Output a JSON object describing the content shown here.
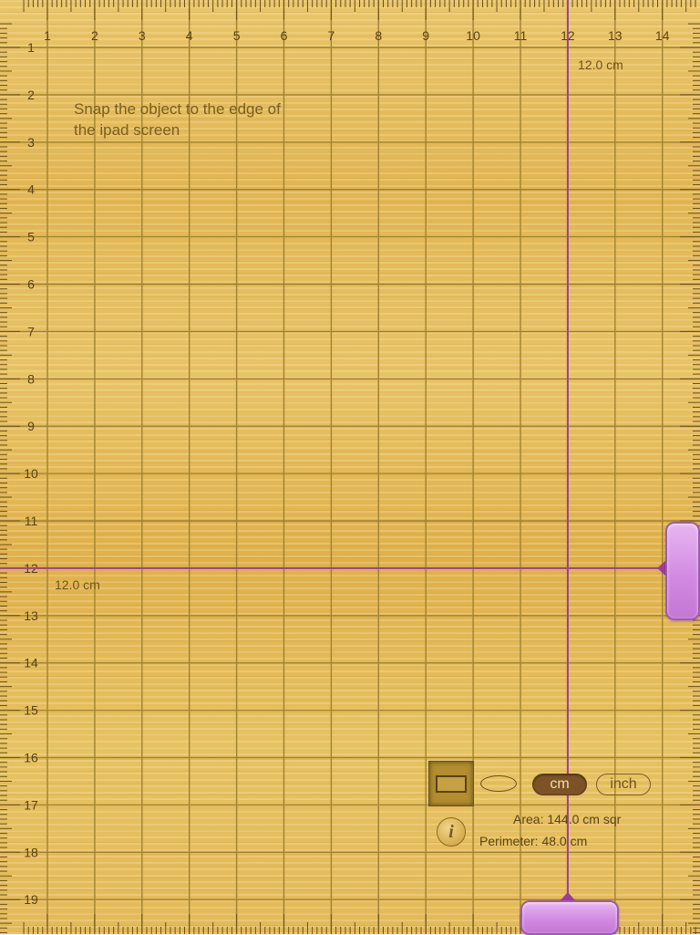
{
  "instruction": "Snap the object to the edge of the ipad screen",
  "measurements": {
    "width_label": "12.0 cm",
    "height_label": "12.0 cm",
    "width_cm": 12.0,
    "height_cm": 12.0,
    "area": "Area: 144.0 cm sqr",
    "perimeter": "Perimeter: 48.0 cm"
  },
  "ruler": {
    "top_numbers": [
      "1",
      "2",
      "3",
      "4",
      "5",
      "6",
      "7",
      "8",
      "9",
      "10",
      "11",
      "12",
      "13",
      "14"
    ],
    "left_numbers": [
      "1",
      "2",
      "3",
      "4",
      "5",
      "6",
      "7",
      "8",
      "9",
      "10",
      "11",
      "12",
      "13",
      "14",
      "15",
      "16",
      "17",
      "18",
      "19"
    ]
  },
  "shapes": {
    "selected": "rectangle",
    "options": [
      "rectangle-icon",
      "ellipse-icon"
    ]
  },
  "units": {
    "cm_label": "cm",
    "inch_label": "inch",
    "selected": "cm"
  },
  "info_label": "i",
  "colors": {
    "guide_line": "#9b3d9e",
    "handle": "#d28be2",
    "grid_line": "#a1822f",
    "wood": "#e6bf63"
  }
}
